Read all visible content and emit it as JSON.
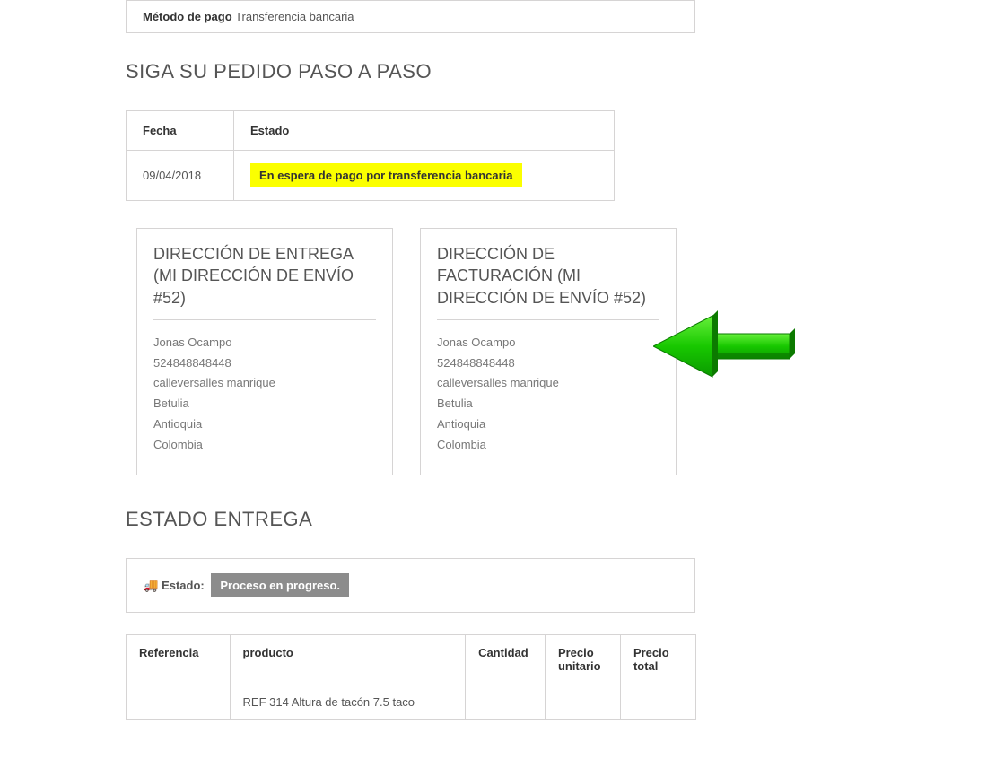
{
  "payment": {
    "label": "Método de pago",
    "value": "Transferencia bancaria"
  },
  "tracking": {
    "title": "SIGA SU PEDIDO PASO A PASO",
    "headers": {
      "date": "Fecha",
      "status": "Estado"
    },
    "rows": [
      {
        "date": "09/04/2018",
        "status": "En espera de pago por transferencia bancaria"
      }
    ],
    "status_color": "#fbff00"
  },
  "addresses": {
    "delivery": {
      "title": "DIRECCIÓN DE ENTREGA (MI DIRECCIÓN DE ENVÍO #52)",
      "lines": [
        "Jonas Ocampo",
        "524848848448",
        "calleversalles manrique",
        "Betulia",
        "Antioquia",
        "Colombia"
      ]
    },
    "invoice": {
      "title": "DIRECCIÓN DE FACTURACIÓN (MI DIRECCIÓN DE ENVÍO #52)",
      "lines": [
        "Jonas Ocampo",
        "524848848448",
        "calleversalles manrique",
        "Betulia",
        "Antioquia",
        "Colombia"
      ]
    }
  },
  "delivery_status": {
    "title": "ESTADO ENTREGA",
    "label": "Estado:",
    "value": "Proceso en progreso."
  },
  "products": {
    "headers": {
      "ref": "Referencia",
      "product": "producto",
      "qty": "Cantidad",
      "unit": "Precio unitario",
      "total": "Precio total"
    },
    "rows": [
      {
        "ref": "",
        "product": "REF 314 Altura de tacón 7.5 taco",
        "qty": "",
        "unit": "",
        "total": ""
      }
    ]
  },
  "colors": {
    "arrow": "#2ecc0e"
  }
}
